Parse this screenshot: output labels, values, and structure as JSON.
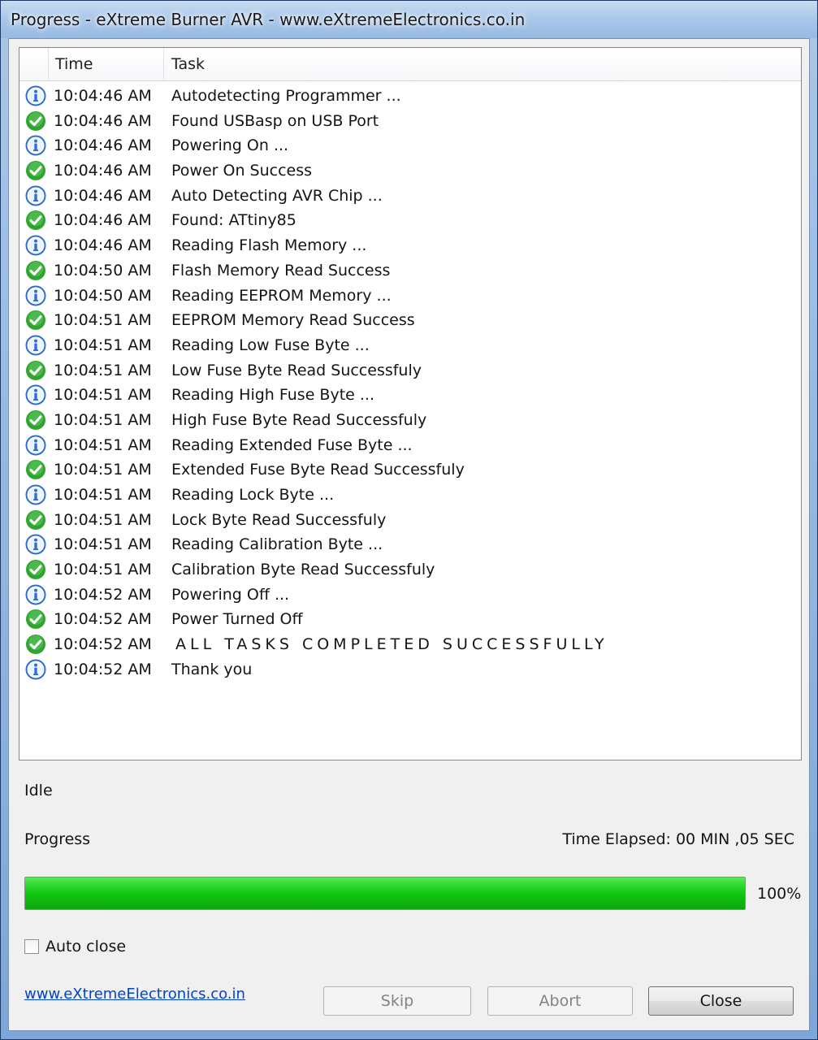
{
  "window": {
    "title": "Progress - eXtreme Burner AVR - www.eXtremeElectronics.co.in"
  },
  "log": {
    "columns": {
      "time": "Time",
      "task": "Task"
    },
    "entries": [
      {
        "icon": "info",
        "time": "10:04:46 AM",
        "task": "Autodetecting Programmer ..."
      },
      {
        "icon": "success",
        "time": "10:04:46 AM",
        "task": "Found USBasp on USB Port"
      },
      {
        "icon": "info",
        "time": "10:04:46 AM",
        "task": "Powering On ..."
      },
      {
        "icon": "success",
        "time": "10:04:46 AM",
        "task": "Power On Success"
      },
      {
        "icon": "info",
        "time": "10:04:46 AM",
        "task": "Auto Detecting AVR Chip ..."
      },
      {
        "icon": "success",
        "time": "10:04:46 AM",
        "task": "Found: ATtiny85"
      },
      {
        "icon": "info",
        "time": "10:04:46 AM",
        "task": "Reading Flash Memory ..."
      },
      {
        "icon": "success",
        "time": "10:04:50 AM",
        "task": "Flash Memory Read Success"
      },
      {
        "icon": "info",
        "time": "10:04:50 AM",
        "task": "Reading EEPROM Memory ..."
      },
      {
        "icon": "success",
        "time": "10:04:51 AM",
        "task": "EEPROM Memory Read Success"
      },
      {
        "icon": "info",
        "time": "10:04:51 AM",
        "task": "Reading Low Fuse Byte ..."
      },
      {
        "icon": "success",
        "time": "10:04:51 AM",
        "task": "Low Fuse Byte Read Successfuly"
      },
      {
        "icon": "info",
        "time": "10:04:51 AM",
        "task": "Reading High Fuse Byte ..."
      },
      {
        "icon": "success",
        "time": "10:04:51 AM",
        "task": "High Fuse Byte Read Successfuly"
      },
      {
        "icon": "info",
        "time": "10:04:51 AM",
        "task": "Reading Extended Fuse Byte ..."
      },
      {
        "icon": "success",
        "time": "10:04:51 AM",
        "task": "Extended Fuse Byte Read Successfuly"
      },
      {
        "icon": "info",
        "time": "10:04:51 AM",
        "task": "Reading Lock Byte ..."
      },
      {
        "icon": "success",
        "time": "10:04:51 AM",
        "task": "Lock Byte Read Successfuly"
      },
      {
        "icon": "info",
        "time": "10:04:51 AM",
        "task": "Reading Calibration Byte ..."
      },
      {
        "icon": "success",
        "time": "10:04:51 AM",
        "task": "Calibration Byte Read Successfuly"
      },
      {
        "icon": "info",
        "time": "10:04:52 AM",
        "task": "Powering Off ..."
      },
      {
        "icon": "success",
        "time": "10:04:52 AM",
        "task": "Power Turned Off"
      },
      {
        "icon": "success",
        "time": "10:04:52 AM",
        "task": "ALL TASKS COMPLETED SUCCESSFULLY",
        "emphasis": true
      },
      {
        "icon": "info",
        "time": "10:04:52 AM",
        "task": "Thank you"
      }
    ]
  },
  "status": {
    "state": "Idle",
    "progress_label": "Progress",
    "elapsed": "Time Elapsed: 00 MIN ,05 SEC",
    "percent_text": "100%",
    "percent_value": 100
  },
  "options": {
    "auto_close_label": "Auto close",
    "auto_close_checked": false
  },
  "footer": {
    "link": "www.eXtremeElectronics.co.in",
    "skip": "Skip",
    "abort": "Abort",
    "close": "Close"
  },
  "colors": {
    "progress_fill": "#10c410",
    "info_icon": "#2f6fd0",
    "success_icon": "#2fa52f",
    "link": "#0044cc"
  }
}
